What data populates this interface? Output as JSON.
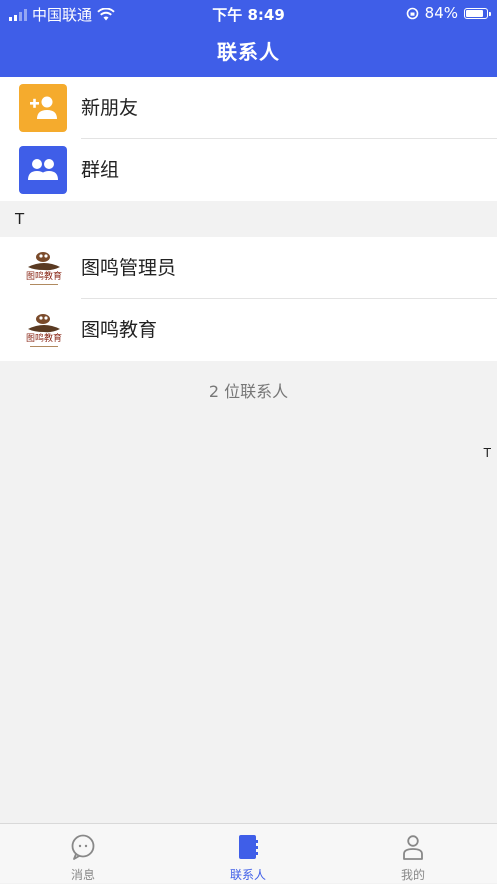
{
  "status_bar": {
    "carrier": "中国联通",
    "time": "下午 8:49",
    "battery": "84%"
  },
  "header": {
    "title": "联系人"
  },
  "special_items": [
    {
      "label": "新朋友",
      "icon": "add-friend-icon",
      "color": "#f5ab2d"
    },
    {
      "label": "群组",
      "icon": "group-icon",
      "color": "#3f5ee8"
    }
  ],
  "sections": [
    {
      "letter": "T",
      "contacts": [
        {
          "name": "图鸣管理员",
          "avatar_text": "图鸣教育"
        },
        {
          "name": "图鸣教育",
          "avatar_text": "图鸣教育"
        }
      ]
    }
  ],
  "contact_count": "2 位联系人",
  "index_letters": [
    "T"
  ],
  "tabs": [
    {
      "label": "消息",
      "icon": "chat-icon",
      "active": false
    },
    {
      "label": "联系人",
      "icon": "contacts-book-icon",
      "active": true
    },
    {
      "label": "我的",
      "icon": "person-icon",
      "active": false
    }
  ],
  "colors": {
    "primary": "#3f5ee8",
    "accent_orange": "#f5ab2d",
    "background": "#f2f2f2"
  }
}
